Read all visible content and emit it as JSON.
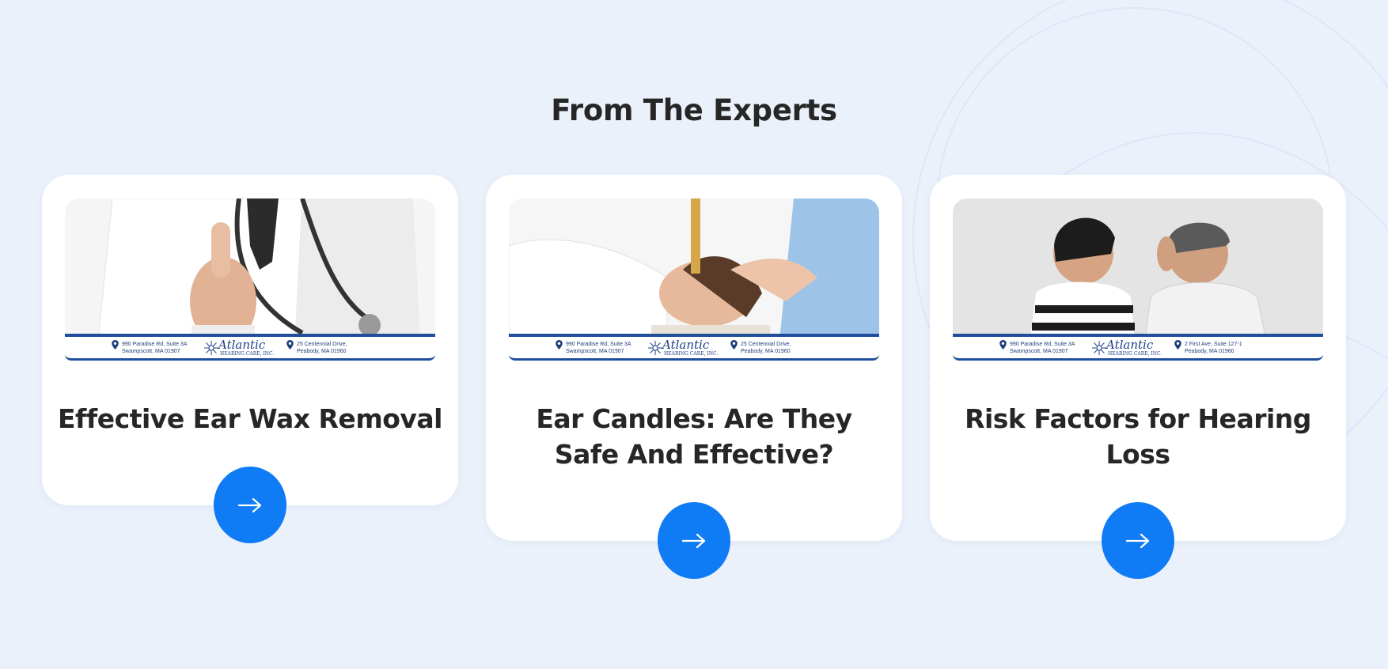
{
  "section": {
    "title": "From The Experts"
  },
  "cards": [
    {
      "title": "Effective Ear Wax Removal",
      "photo_icon": "doctor-thumbs-up-photo",
      "strip": {
        "left_line1": "990 Paradise Rd, Suite 3A",
        "left_line2": "Swampscott, MA 01907",
        "brand_name": "Atlantic",
        "brand_sub": "HEARING CARE, INC.",
        "right_line1": "25 Centennial Drive,",
        "right_line2": "Peabody, MA 01960"
      },
      "button_icon": "arrow-right-icon"
    },
    {
      "title": "Ear Candles: Are They Safe And Effective?",
      "photo_icon": "ear-candling-photo",
      "strip": {
        "left_line1": "990 Paradise Rd, Suite 3A",
        "left_line2": "Swampscott, MA 01907",
        "brand_name": "Atlantic",
        "brand_sub": "HEARING CARE, INC.",
        "right_line1": "25 Centennial Drive,",
        "right_line2": "Peabody, MA 01960"
      },
      "button_icon": "arrow-right-icon"
    },
    {
      "title": "Risk Factors for Hearing Loss",
      "photo_icon": "couple-whispering-photo",
      "strip": {
        "left_line1": "990 Paradise Rd, Suite 3A",
        "left_line2": "Swampscott, MA 01907",
        "brand_name": "Atlantic",
        "brand_sub": "HEARING CARE, INC.",
        "right_line1": "2 First Ave, Suite 127-1",
        "right_line2": "Peabody, MA 01960"
      },
      "button_icon": "arrow-right-icon"
    }
  ],
  "colors": {
    "page_background": "#eaf1fb",
    "card_background": "#ffffff",
    "button_blue": "#0f7bf5",
    "heading_text": "#262626",
    "strip_blue": "#1f4f9c"
  }
}
